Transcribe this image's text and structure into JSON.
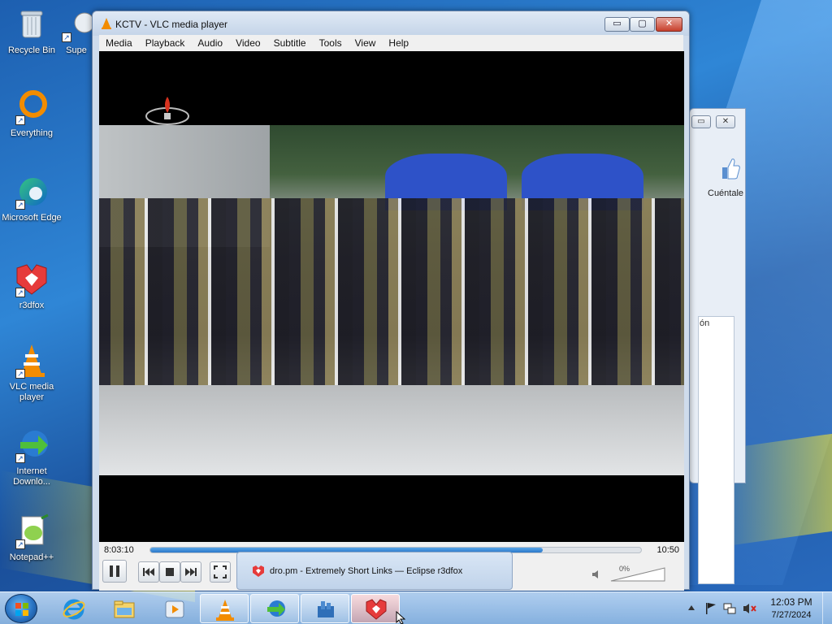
{
  "desktop": {
    "icons": [
      {
        "label": "Recycle Bin",
        "icon": "recycle-bin-icon"
      },
      {
        "label": "Supe",
        "icon": "app-icon"
      },
      {
        "label": "Everything",
        "icon": "everything-icon"
      },
      {
        "label": "Microsoft Edge",
        "icon": "edge-icon"
      },
      {
        "label": "r3dfox",
        "icon": "r3dfox-icon"
      },
      {
        "label": "VLC media player",
        "icon": "vlc-icon"
      },
      {
        "label": "Internet Downlo...",
        "icon": "idm-icon"
      },
      {
        "label": "Notepad++",
        "icon": "notepadpp-icon"
      }
    ]
  },
  "background_window": {
    "label": "Cuéntale",
    "column": "ón",
    "buttons": [
      "▭",
      "✕"
    ]
  },
  "vlc": {
    "title": "KCTV - VLC media player",
    "window_buttons": {
      "minimize": "▭",
      "maximize": "▢",
      "close": "✕"
    },
    "menu": [
      "Media",
      "Playback",
      "Audio",
      "Video",
      "Subtitle",
      "Tools",
      "View",
      "Help"
    ],
    "time_current": "8:03:10",
    "time_total": "10:50",
    "progress_fraction": 0.8,
    "volume_percent": "0%"
  },
  "popup": {
    "text": "dro.pm - Extremely Short Links — Eclipse r3dfox"
  },
  "taskbar": {
    "clock_time": "12:03 PM",
    "clock_date": "7/27/2024",
    "items": [
      "ie-icon",
      "explorer-icon",
      "media-player-icon",
      "vlc-icon",
      "idm-icon",
      "app-store-icon",
      "r3dfox-icon"
    ]
  },
  "colors": {
    "accent": "#2b78c9",
    "close_red": "#c7402c",
    "vlc_orange": "#f28c00"
  }
}
